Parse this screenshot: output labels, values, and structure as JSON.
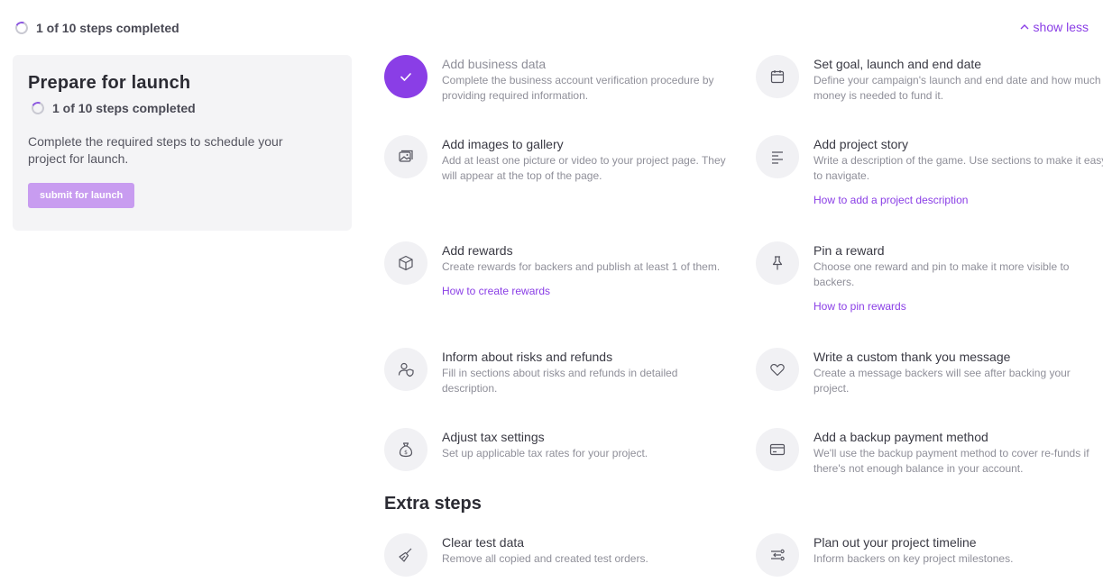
{
  "progress": {
    "text": "1 of 10 steps completed",
    "completed": 1,
    "total": 10
  },
  "show_less_label": "show less",
  "prepare_card": {
    "title": "Prepare for launch",
    "progress_text": "1 of 10 steps completed",
    "description": "Complete the required steps to schedule your project for launch.",
    "submit_label": "submit for launch"
  },
  "steps": [
    {
      "title": "Add business data",
      "desc": "Complete the business account verification procedure by providing required information.",
      "icon": "check-icon",
      "done": true
    },
    {
      "title": "Set goal, launch and end date",
      "desc": "Define your campaign's launch and end date and how much money is needed to fund it.",
      "icon": "calendar-icon"
    },
    {
      "title": "Add images to gallery",
      "desc": "Add at least one picture or video to your project page. They will appear at the top of the page.",
      "icon": "image-gallery-icon"
    },
    {
      "title": "Add project story",
      "desc": "Write a description of the game. Use sections to make it easy to navigate.",
      "icon": "text-lines-icon",
      "link": "How to add a project description"
    },
    {
      "title": "Add rewards",
      "desc": "Create rewards for backers and publish at least 1 of them.",
      "icon": "box-icon",
      "link": "How to create rewards"
    },
    {
      "title": "Pin a reward",
      "desc": "Choose one reward and pin to make it more visible to backers.",
      "icon": "pin-icon",
      "link": "How to pin rewards"
    },
    {
      "title": "Inform about risks and refunds",
      "desc": "Fill in sections about risks and refunds in detailed description.",
      "icon": "user-shield-icon"
    },
    {
      "title": "Write a custom thank you message",
      "desc": "Create a message backers will see after backing your project.",
      "icon": "heart-icon"
    },
    {
      "title": "Adjust tax settings",
      "desc": "Set up applicable tax rates for your project.",
      "icon": "money-bag-icon"
    },
    {
      "title": "Add a backup payment method",
      "desc": "We'll use the backup payment method to cover re-funds if there's not enough balance in your account.",
      "icon": "credit-card-icon"
    }
  ],
  "extra_heading": "Extra steps",
  "extra_steps": [
    {
      "title": "Clear test data",
      "desc": "Remove all copied and created test orders.",
      "icon": "broom-icon"
    },
    {
      "title": "Plan out your project timeline",
      "desc": "Inform backers on key project milestones.",
      "icon": "timeline-icon"
    }
  ]
}
